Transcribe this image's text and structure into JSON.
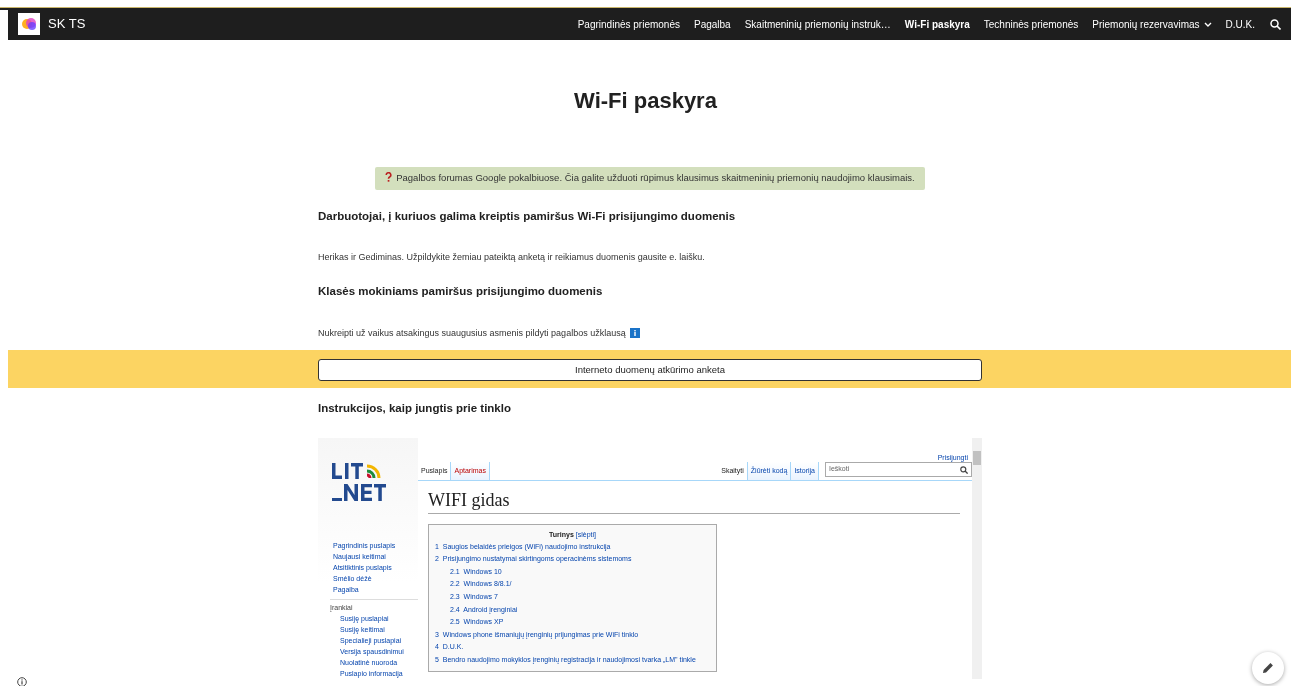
{
  "navbar": {
    "brand": "SK TS",
    "items": [
      {
        "label": "Pagrindinės priemonės",
        "selected": false,
        "kind": "link"
      },
      {
        "label": "Pagalba",
        "selected": false,
        "kind": "link"
      },
      {
        "label": "Skaitmeninių priemonių instruk…",
        "selected": false,
        "kind": "link"
      },
      {
        "label": "Wi-Fi paskyra",
        "selected": true,
        "kind": "link"
      },
      {
        "label": "Techninės priemonės",
        "selected": false,
        "kind": "link"
      },
      {
        "label": "Priemonių rezervavimas",
        "selected": false,
        "kind": "dropdown"
      },
      {
        "label": "D.U.K.",
        "selected": false,
        "kind": "link"
      }
    ]
  },
  "title": "Wi-Fi paskyra",
  "help_banner": "Pagalbos forumas Google pokalbiuose. Čia galite užduoti rūpimus klausimus skaitmeninių priemonių naudojimo klausimais.",
  "sections": [
    {
      "heading": "Darbuotojai, į kuriuos galima kreiptis pamiršus Wi-Fi prisijungimo duomenis",
      "text": "Herikas ir Gediminas. Užpildykite žemiau pateiktą anketą ir reikiamus duomenis gausite e. laišku.",
      "kind": "plain"
    },
    {
      "heading": "Klasės mokiniams pamiršus prisijungimo duomenis",
      "text": "Nukreipti už vaikus atsakingus suaugusius asmenis pildyti pagalbos užklausą",
      "kind": "with_info_icon"
    }
  ],
  "form_button": "Interneto duomenų atkūrimo anketa",
  "instructions_heading": "Instrukcijos, kaip jungtis prie tinklo",
  "wiki": {
    "login": "Prisijungti",
    "left_tabs": [
      {
        "label": "Puslapis",
        "selected": true
      },
      {
        "label": "Aptarimas",
        "selected": false
      }
    ],
    "right_tabs": [
      {
        "label": "Skaityti",
        "selected": true
      },
      {
        "label": "Žiūrėti kodą",
        "selected": false
      },
      {
        "label": "Istorija",
        "selected": false
      }
    ],
    "search": {
      "placeholder": "Ieškoti"
    },
    "nav": [
      "Pagrindinis puslapis",
      "Naujausi keitimai",
      "Atsitiktinis puslapis",
      "Smėlio dėžė",
      "Pagalba"
    ],
    "tools_heading": "Įrankiai",
    "tools": [
      "Susiję puslapiai",
      "Susiję keitimai",
      "Specialieji puslapiai",
      "Versija spausdinimui",
      "Nuolatinė nuoroda",
      "Puslapio informacija"
    ],
    "page_title": "WIFI gidas",
    "toc": {
      "title": "Turinys",
      "toggle": "[slėpti]",
      "items": [
        {
          "number": "1",
          "label": "Saugios belaidės prieigos (WiFi) naudojimo instrukcija"
        },
        {
          "number": "2",
          "label": "Prisijungimo nustatymai skirtingoms operacinėms sistemoms",
          "children": [
            {
              "number": "2.1",
              "label": "Windows 10"
            },
            {
              "number": "2.2",
              "label": "Windows 8/8.1/"
            },
            {
              "number": "2.3",
              "label": "Windows 7"
            },
            {
              "number": "2.4",
              "label": "Android įrenginiai"
            },
            {
              "number": "2.5",
              "label": "Windows XP"
            }
          ]
        },
        {
          "number": "3",
          "label": "Windows phone išmaniųjų įrenginių prijungimas prie WiFi tinklo"
        },
        {
          "number": "4",
          "label": "D.U.K."
        },
        {
          "number": "5",
          "label": "Bendro naudojimo mokyklos įrenginių registracija ir naudojimosi tvarka „LM\" tinkle"
        }
      ]
    }
  }
}
